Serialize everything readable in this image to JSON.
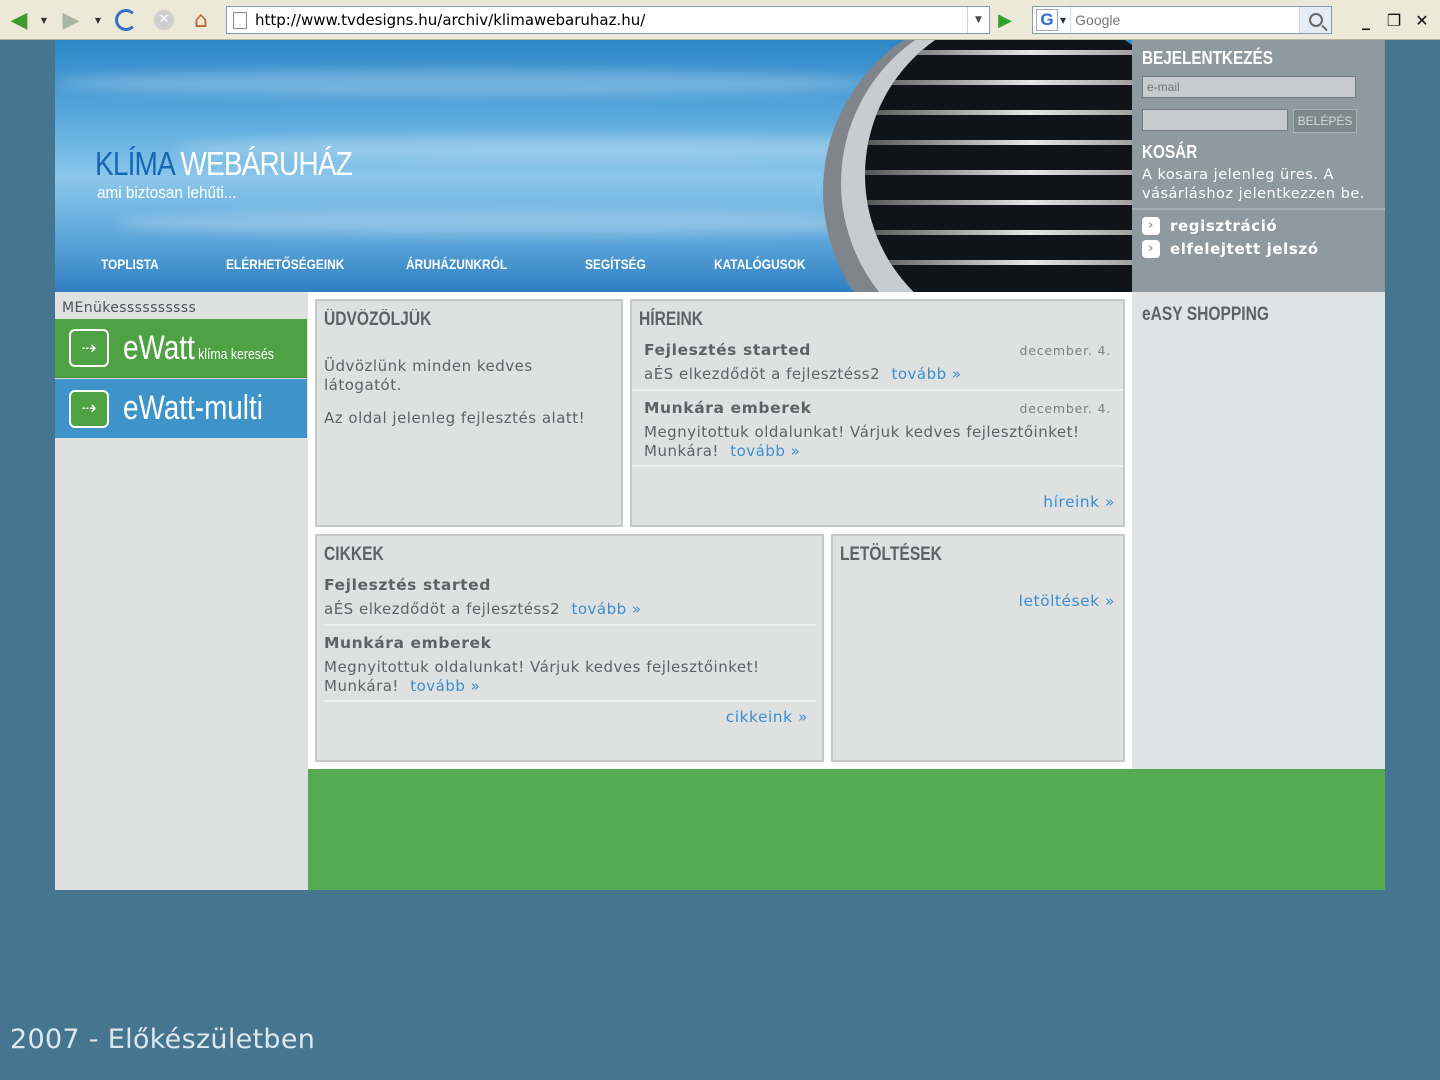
{
  "browser": {
    "url": "http://www.tvdesigns.hu/archiv/klimawebaruhaz.hu/",
    "search_placeholder": "Google",
    "search_engine_icon": "G"
  },
  "header": {
    "brand_part1": "KLÍMA",
    "brand_part2": "WEBÁRUHÁZ",
    "slogan": "ami biztosan lehűti...",
    "nav": [
      "TOPLISTA",
      "ELÉRHETŐSÉGEINK",
      "ÁRUHÁZUNKRÓL",
      "SEGÍTSÉG",
      "KATALÓGUSOK"
    ]
  },
  "login": {
    "title": "BEJELENTKEZÉS",
    "email_placeholder": "e-mail",
    "password_value": "",
    "submit_label": "BELÉPÉS",
    "cart_title": "KOSÁR",
    "cart_text": "A kosara jelenleg üres. A vásárláshoz jelentkezzen be.",
    "links": [
      "regisztráció",
      "elfelejtett jelszó"
    ],
    "link_bullet": "›"
  },
  "menu": {
    "title": "MEnükessssssssss",
    "buttons": [
      {
        "label": "eWatt",
        "sub": "klíma keresés",
        "color": "#4ea244"
      },
      {
        "label": "eWatt-multi",
        "sub": "",
        "color": "#3e93c9"
      }
    ]
  },
  "welcome": {
    "title": "ÜDVÖZÖLJÜK",
    "p1": "Üdvözlünk minden kedves látogatót.",
    "p2": "Az oldal jelenleg fejlesztés alatt!"
  },
  "news": {
    "title": "HÍREINK",
    "items": [
      {
        "title": "Fejlesztés started",
        "date": "december. 4.",
        "text": "aÉS elkezdődöt a fejlesztéss2",
        "more": "tovább »"
      },
      {
        "title": "Munkára emberek",
        "date": "december. 4.",
        "text": "Megnyitottuk oldalunkat! Várjuk kedves fejlesztőinket! Munkára!",
        "more": "tovább »"
      }
    ],
    "all_link": "híreink »"
  },
  "articles": {
    "title": "CIKKEK",
    "items": [
      {
        "title": "Fejlesztés started",
        "text": "aÉS elkezdődöt a fejlesztéss2",
        "more": "tovább »"
      },
      {
        "title": "Munkára emberek",
        "text": "Megnyitottuk oldalunkat! Várjuk kedves fejlesztőinket! Munkára!",
        "more": "tovább »"
      }
    ],
    "all_link": "cikkeink »"
  },
  "downloads": {
    "title": "LETÖLTÉSEK",
    "all_link": "letöltések »"
  },
  "right": {
    "title": "eASY SHOPPING"
  },
  "caption": "2007 - Előkészületben",
  "colors": {
    "background": "#46758f",
    "footer_green": "#56ab52",
    "link_blue": "#3a8ed1",
    "login_gray": "#8e9a9f"
  }
}
